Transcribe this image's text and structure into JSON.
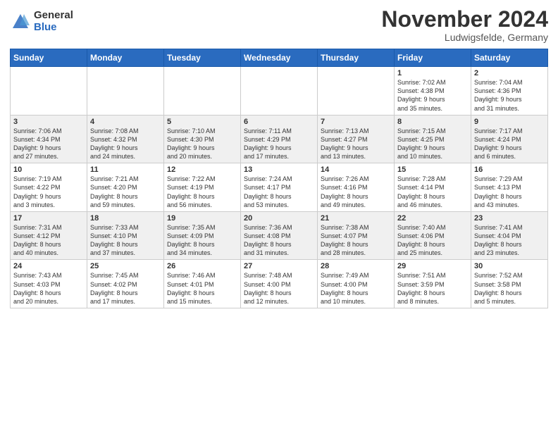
{
  "header": {
    "logo_general": "General",
    "logo_blue": "Blue",
    "month_title": "November 2024",
    "location": "Ludwigsfelde, Germany"
  },
  "days_of_week": [
    "Sunday",
    "Monday",
    "Tuesday",
    "Wednesday",
    "Thursday",
    "Friday",
    "Saturday"
  ],
  "weeks": [
    [
      {
        "day": "",
        "info": ""
      },
      {
        "day": "",
        "info": ""
      },
      {
        "day": "",
        "info": ""
      },
      {
        "day": "",
        "info": ""
      },
      {
        "day": "",
        "info": ""
      },
      {
        "day": "1",
        "info": "Sunrise: 7:02 AM\nSunset: 4:38 PM\nDaylight: 9 hours\nand 35 minutes."
      },
      {
        "day": "2",
        "info": "Sunrise: 7:04 AM\nSunset: 4:36 PM\nDaylight: 9 hours\nand 31 minutes."
      }
    ],
    [
      {
        "day": "3",
        "info": "Sunrise: 7:06 AM\nSunset: 4:34 PM\nDaylight: 9 hours\nand 27 minutes."
      },
      {
        "day": "4",
        "info": "Sunrise: 7:08 AM\nSunset: 4:32 PM\nDaylight: 9 hours\nand 24 minutes."
      },
      {
        "day": "5",
        "info": "Sunrise: 7:10 AM\nSunset: 4:30 PM\nDaylight: 9 hours\nand 20 minutes."
      },
      {
        "day": "6",
        "info": "Sunrise: 7:11 AM\nSunset: 4:29 PM\nDaylight: 9 hours\nand 17 minutes."
      },
      {
        "day": "7",
        "info": "Sunrise: 7:13 AM\nSunset: 4:27 PM\nDaylight: 9 hours\nand 13 minutes."
      },
      {
        "day": "8",
        "info": "Sunrise: 7:15 AM\nSunset: 4:25 PM\nDaylight: 9 hours\nand 10 minutes."
      },
      {
        "day": "9",
        "info": "Sunrise: 7:17 AM\nSunset: 4:24 PM\nDaylight: 9 hours\nand 6 minutes."
      }
    ],
    [
      {
        "day": "10",
        "info": "Sunrise: 7:19 AM\nSunset: 4:22 PM\nDaylight: 9 hours\nand 3 minutes."
      },
      {
        "day": "11",
        "info": "Sunrise: 7:21 AM\nSunset: 4:20 PM\nDaylight: 8 hours\nand 59 minutes."
      },
      {
        "day": "12",
        "info": "Sunrise: 7:22 AM\nSunset: 4:19 PM\nDaylight: 8 hours\nand 56 minutes."
      },
      {
        "day": "13",
        "info": "Sunrise: 7:24 AM\nSunset: 4:17 PM\nDaylight: 8 hours\nand 53 minutes."
      },
      {
        "day": "14",
        "info": "Sunrise: 7:26 AM\nSunset: 4:16 PM\nDaylight: 8 hours\nand 49 minutes."
      },
      {
        "day": "15",
        "info": "Sunrise: 7:28 AM\nSunset: 4:14 PM\nDaylight: 8 hours\nand 46 minutes."
      },
      {
        "day": "16",
        "info": "Sunrise: 7:29 AM\nSunset: 4:13 PM\nDaylight: 8 hours\nand 43 minutes."
      }
    ],
    [
      {
        "day": "17",
        "info": "Sunrise: 7:31 AM\nSunset: 4:12 PM\nDaylight: 8 hours\nand 40 minutes."
      },
      {
        "day": "18",
        "info": "Sunrise: 7:33 AM\nSunset: 4:10 PM\nDaylight: 8 hours\nand 37 minutes."
      },
      {
        "day": "19",
        "info": "Sunrise: 7:35 AM\nSunset: 4:09 PM\nDaylight: 8 hours\nand 34 minutes."
      },
      {
        "day": "20",
        "info": "Sunrise: 7:36 AM\nSunset: 4:08 PM\nDaylight: 8 hours\nand 31 minutes."
      },
      {
        "day": "21",
        "info": "Sunrise: 7:38 AM\nSunset: 4:07 PM\nDaylight: 8 hours\nand 28 minutes."
      },
      {
        "day": "22",
        "info": "Sunrise: 7:40 AM\nSunset: 4:06 PM\nDaylight: 8 hours\nand 25 minutes."
      },
      {
        "day": "23",
        "info": "Sunrise: 7:41 AM\nSunset: 4:04 PM\nDaylight: 8 hours\nand 23 minutes."
      }
    ],
    [
      {
        "day": "24",
        "info": "Sunrise: 7:43 AM\nSunset: 4:03 PM\nDaylight: 8 hours\nand 20 minutes."
      },
      {
        "day": "25",
        "info": "Sunrise: 7:45 AM\nSunset: 4:02 PM\nDaylight: 8 hours\nand 17 minutes."
      },
      {
        "day": "26",
        "info": "Sunrise: 7:46 AM\nSunset: 4:01 PM\nDaylight: 8 hours\nand 15 minutes."
      },
      {
        "day": "27",
        "info": "Sunrise: 7:48 AM\nSunset: 4:00 PM\nDaylight: 8 hours\nand 12 minutes."
      },
      {
        "day": "28",
        "info": "Sunrise: 7:49 AM\nSunset: 4:00 PM\nDaylight: 8 hours\nand 10 minutes."
      },
      {
        "day": "29",
        "info": "Sunrise: 7:51 AM\nSunset: 3:59 PM\nDaylight: 8 hours\nand 8 minutes."
      },
      {
        "day": "30",
        "info": "Sunrise: 7:52 AM\nSunset: 3:58 PM\nDaylight: 8 hours\nand 5 minutes."
      }
    ]
  ]
}
